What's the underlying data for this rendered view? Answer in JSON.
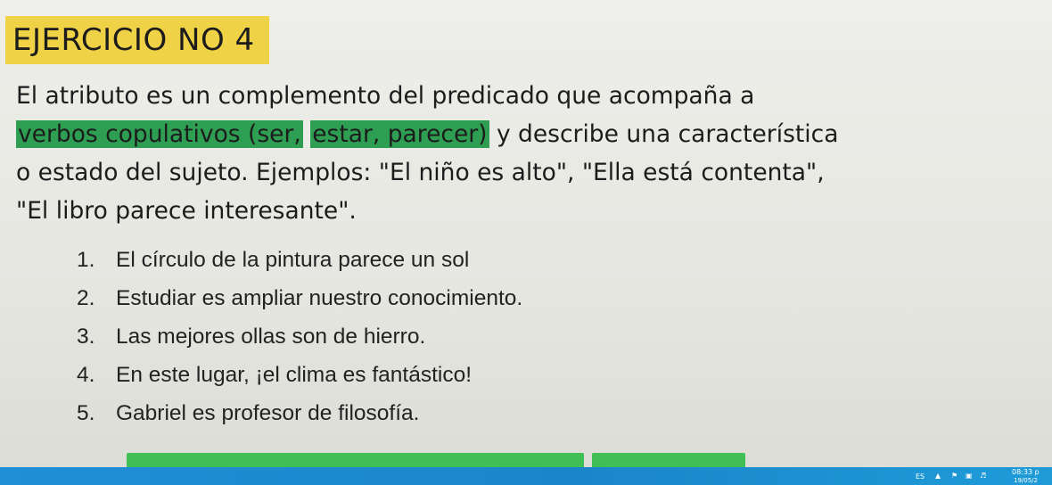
{
  "title": "EJERCICIO NO 4",
  "paragraph": {
    "l1": "El atributo es un complemento del predicado que acompaña a",
    "l2_hl1": "verbos copulativos (ser,",
    "l2_hl2": "estar, parecer)",
    "l2_rest": "y describe una característica",
    "l3": "o estado del sujeto. Ejemplos: \"El niño es alto\", \"Ella está contenta\",",
    "l4": "\"El libro parece interesante\"."
  },
  "items": [
    {
      "num": "1.",
      "text": "El círculo de la pintura parece un sol"
    },
    {
      "num": "2.",
      "text": "Estudiar es ampliar nuestro conocimiento."
    },
    {
      "num": "3.",
      "text": "Las mejores ollas son de hierro."
    },
    {
      "num": "4.",
      "text": "En este lugar, ¡el clima es fantástico!"
    },
    {
      "num": "5.",
      "text": "Gabriel es profesor de filosofía."
    }
  ],
  "taskbar": {
    "language": "ES",
    "time": "08:33 p",
    "date": "19/05/2"
  },
  "icons": [
    "chevron-up-icon",
    "flag-icon",
    "network-icon",
    "volume-icon"
  ],
  "colors": {
    "title_highlight": "#f0d246",
    "text_highlight": "#2e9e52",
    "taskbar": "#1f8fd6"
  }
}
